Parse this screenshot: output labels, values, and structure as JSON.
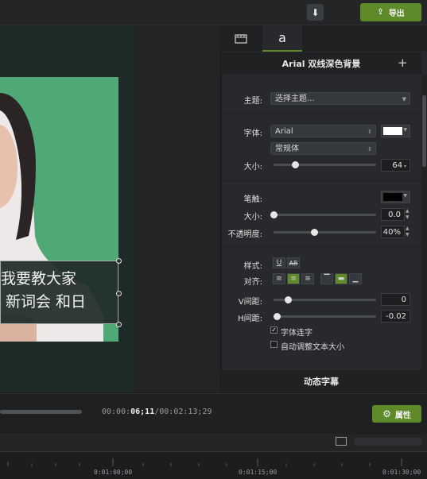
{
  "toolbar": {
    "export_label": "导出",
    "download_icon": "download-icon",
    "export_icon": "share-export-icon"
  },
  "canvas": {
    "caption_line1": "我要教大家",
    "caption_line2": "新词会 和日"
  },
  "panel": {
    "tab_media_icon": "film-icon",
    "tab_text_label": "a",
    "title": "Arial 双线深色背景",
    "theme_label": "主题:",
    "theme_value": "选择主题...",
    "font_label": "字体:",
    "font_value": "Arial",
    "font_style_value": "常规体",
    "size_label": "大小:",
    "size_value": "64",
    "stroke_label": "笔触:",
    "stroke_size_label": "大小:",
    "stroke_size_value": "0.0",
    "opacity_label": "不透明度:",
    "opacity_value": "40%",
    "style_label": "样式:",
    "align_label": "对齐:",
    "vspace_label": "V间距:",
    "vspace_value": "0",
    "hspace_label": "H间距:",
    "hspace_value": "-0.02",
    "ligature_label": "字体连字",
    "ligature_checked": true,
    "autosize_label": "自动调整文本大小",
    "autosize_checked": false,
    "animated_caption_label": "动态字幕",
    "font_color": "#ffffff",
    "stroke_color": "#000000"
  },
  "playback": {
    "time_prefix": "00:00:",
    "time_current": "06;11",
    "time_total": "/00:02:13;29",
    "properties_label": "属性"
  },
  "timeline": {
    "marks": [
      "0:01:00;00",
      "0:01:15;00",
      "0:01:30;00"
    ]
  },
  "colors": {
    "accent": "#5f8a2a",
    "green_screen": "#4fa876"
  }
}
